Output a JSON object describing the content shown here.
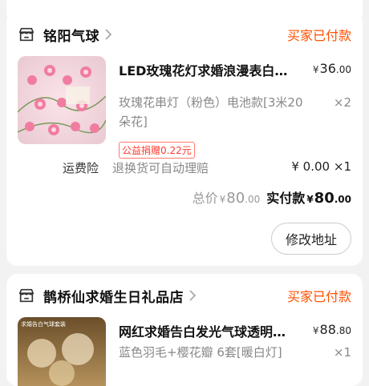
{
  "orders": [
    {
      "shop_name": "铭阳气球",
      "status": "买家已付款",
      "item": {
        "title": "LED玫瑰花灯求婚浪漫表白…",
        "price_currency": "¥",
        "price_int": "36",
        "price_dec": ".00",
        "spec": "玫瑰花串灯（粉色）电池款[3米20朵花]",
        "qty": "×2",
        "badge": "公益捐赠0.22元"
      },
      "shipping": {
        "label": "运费险",
        "desc": "退换货可自动理赔",
        "price": "¥ 0.00",
        "qty": "×1"
      },
      "total": {
        "label": "总价",
        "currency": "¥",
        "int": "80",
        "dec": ".00",
        "paid_label": "实付款",
        "paid_currency": "¥",
        "paid_int": "80",
        "paid_dec": ".00"
      },
      "action_button": "修改地址"
    },
    {
      "shop_name": "鹊桥仙求婚生日礼品店",
      "status": "买家已付款",
      "item": {
        "title": "网红求婚告白发光气球透明…",
        "price_currency": "¥",
        "price_int": "88",
        "price_dec": ".80",
        "spec": "蓝色羽毛+樱花瓣 6套[暖白灯]",
        "qty": "×1",
        "thumb_caption": "求婚告白气球套装"
      }
    }
  ],
  "colors": {
    "accent": "#ff5000",
    "muted": "#888888",
    "bg": "#f2f2f2"
  },
  "icons": {
    "shop": "store-icon",
    "chevron": "chevron-right-icon"
  }
}
